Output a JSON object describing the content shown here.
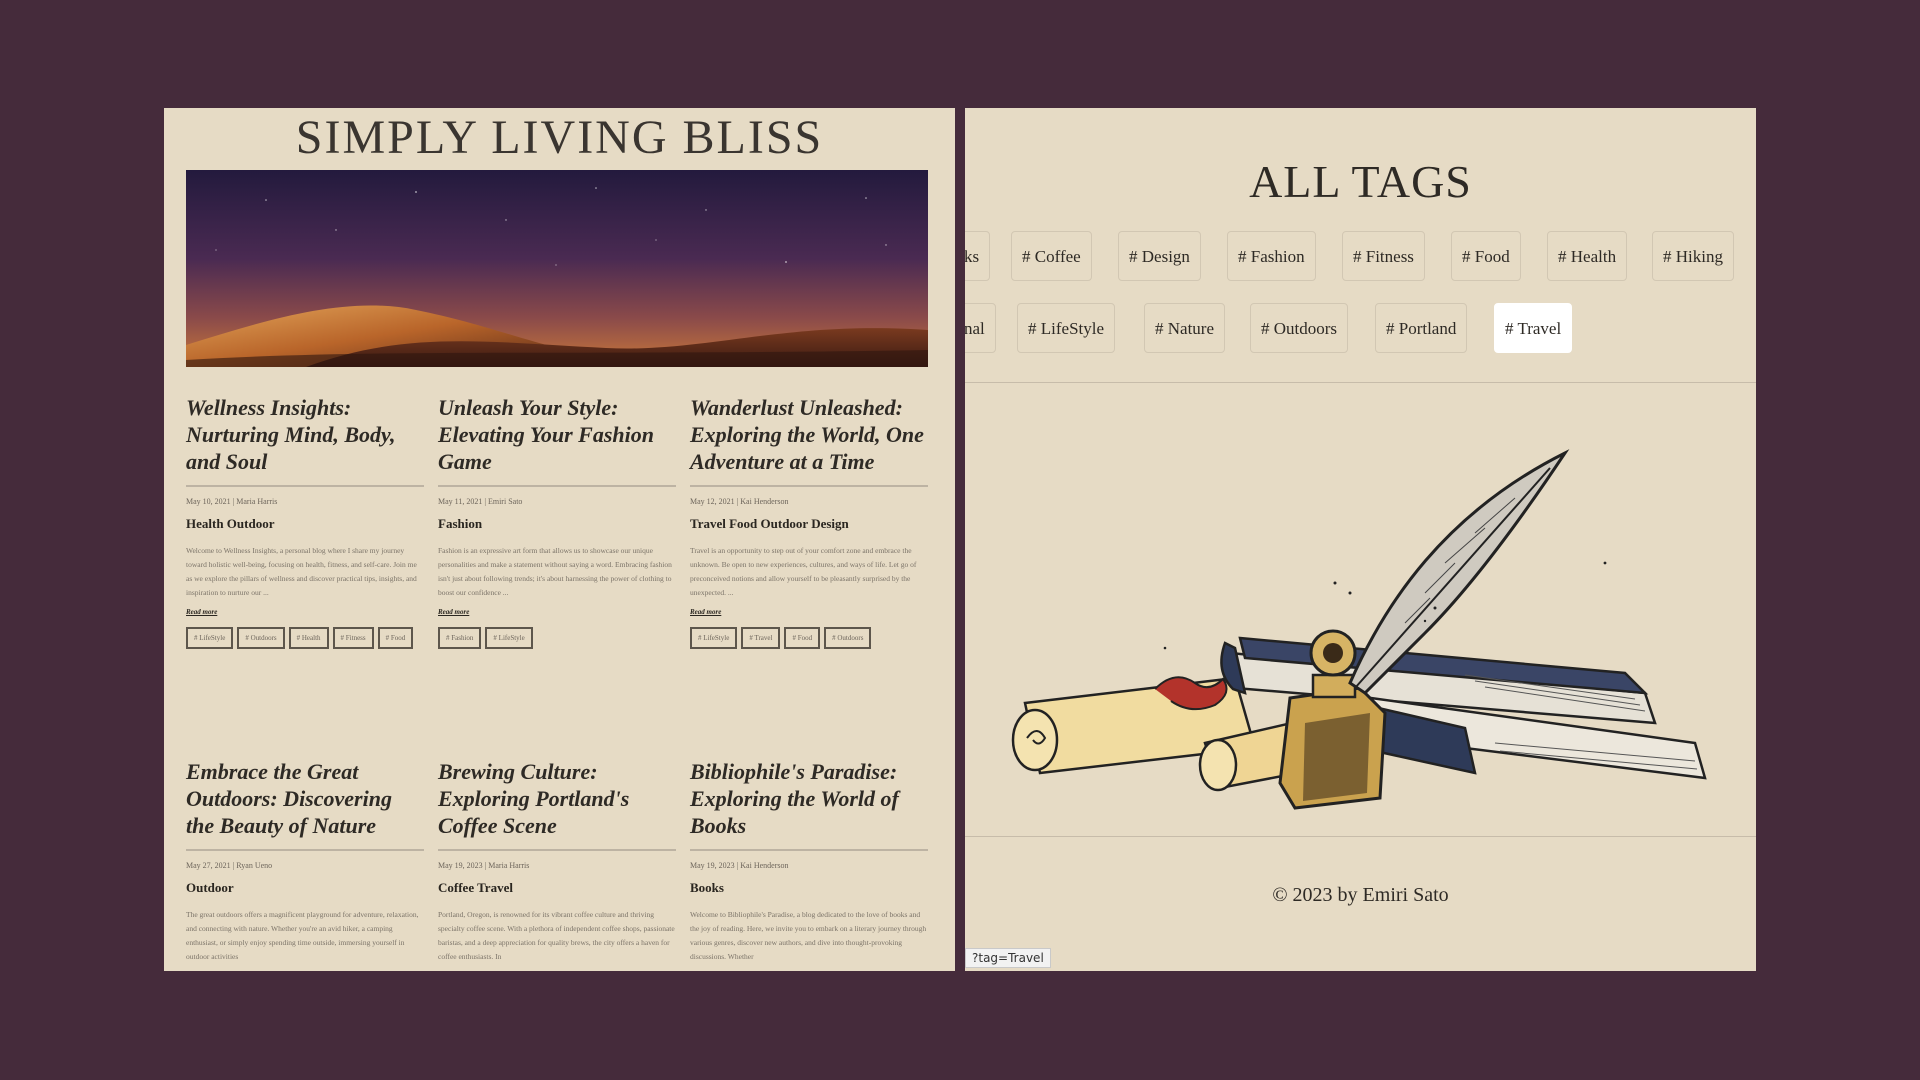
{
  "left": {
    "site_title": "SIMPLY LIVING BLISS",
    "posts": [
      {
        "title": "Wellness Insights: Nurturing Mind, Body, and Soul",
        "meta": "May 10, 2021 | Maria Harris",
        "tags_line": "Health  Outdoor",
        "excerpt": "Welcome to Wellness Insights, a personal blog where I share my journey toward holistic well-being, focusing on health, fitness, and self-care. Join me as we explore the pillars of wellness and discover practical tips, insights, and inspiration to nurture our ...",
        "read_more": "Read more",
        "chips": [
          "# LifeStyle",
          "# Outdoors",
          "# Health",
          "# Fitness",
          "# Food"
        ]
      },
      {
        "title": "Unleash Your Style: Elevating Your Fashion Game",
        "meta": "May 11, 2021 | Emiri Sato",
        "tags_line": "Fashion",
        "excerpt": "Fashion is an expressive art form that allows us to showcase our unique personalities and make a statement without saying a word. Embracing fashion isn't just about following trends; it's about harnessing the power of clothing to boost our confidence ...",
        "read_more": "Read more",
        "chips": [
          "# Fashion",
          "# LifeStyle"
        ]
      },
      {
        "title": "Wanderlust Unleashed: Exploring the World, One Adventure at a Time",
        "meta": "May 12, 2021 | Kai Henderson",
        "tags_line": "Travel Food Outdoor Design",
        "excerpt": "Travel is an opportunity to step out of your comfort zone and embrace the unknown. Be open to new experiences, cultures, and ways of life. Let go of preconceived notions and allow yourself to be pleasantly surprised by the unexpected. ...",
        "read_more": "Read more",
        "chips": [
          "# LifeStyle",
          "# Travel",
          "# Food",
          "# Outdoors"
        ]
      },
      {
        "title": "Embrace the Great Outdoors: Discovering the Beauty of Nature",
        "meta": "May 27, 2021 | Ryan Ueno",
        "tags_line": "Outdoor",
        "excerpt": "The great outdoors offers a magnificent playground for adventure, relaxation, and connecting with nature. Whether you're an avid hiker, a camping enthusiast, or simply enjoy spending time outside, immersing yourself in outdoor activities"
      },
      {
        "title": "Brewing Culture: Exploring Portland's Coffee Scene",
        "meta": "May 19, 2023 | Maria Harris",
        "tags_line": "Coffee Travel",
        "excerpt": "Portland, Oregon, is renowned for its vibrant coffee culture and thriving specialty coffee scene. With a plethora of independent coffee shops, passionate baristas, and a deep appreciation for quality brews, the city offers a haven for coffee enthusiasts. In"
      },
      {
        "title": "Bibliophile's Paradise: Exploring the World of Books",
        "meta": "May 19, 2023 | Kai Henderson",
        "tags_line": "Books",
        "excerpt": "Welcome to Bibliophile's Paradise, a blog dedicated to the love of books and the joy of reading. Here, we invite you to embark on a literary journey through various genres, discover new authors, and dive into thought-provoking discussions. Whether"
      }
    ]
  },
  "right": {
    "title": "ALL TAGS",
    "tags_row1": [
      "ks",
      "# Coffee",
      "# Design",
      "# Fashion",
      "# Fitness",
      "# Food",
      "# Health",
      "# Hiking"
    ],
    "tags_row2": [
      "nal",
      "# LifeStyle",
      "# Nature",
      "# Outdoors",
      "# Portland",
      "# Travel"
    ],
    "active_tag": "# Travel",
    "footer": "© 2023 by Emiri Sato",
    "status_url": "?tag=Travel"
  },
  "colors": {
    "page_background": "#452b3b",
    "panel_background": "#e6dbc5",
    "active_tag_background": "#ffffff"
  }
}
